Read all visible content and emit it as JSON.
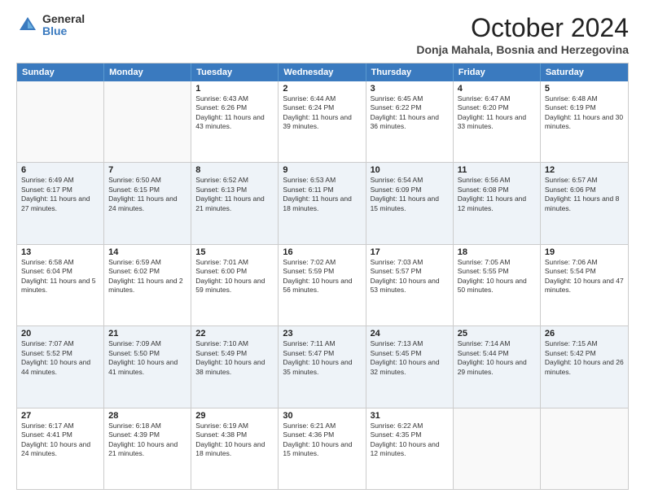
{
  "logo": {
    "general": "General",
    "blue": "Blue"
  },
  "header": {
    "month": "October 2024",
    "location": "Donja Mahala, Bosnia and Herzegovina"
  },
  "days": [
    "Sunday",
    "Monday",
    "Tuesday",
    "Wednesday",
    "Thursday",
    "Friday",
    "Saturday"
  ],
  "weeks": [
    [
      {
        "day": "",
        "info": ""
      },
      {
        "day": "",
        "info": ""
      },
      {
        "day": "1",
        "info": "Sunrise: 6:43 AM\nSunset: 6:26 PM\nDaylight: 11 hours and 43 minutes."
      },
      {
        "day": "2",
        "info": "Sunrise: 6:44 AM\nSunset: 6:24 PM\nDaylight: 11 hours and 39 minutes."
      },
      {
        "day": "3",
        "info": "Sunrise: 6:45 AM\nSunset: 6:22 PM\nDaylight: 11 hours and 36 minutes."
      },
      {
        "day": "4",
        "info": "Sunrise: 6:47 AM\nSunset: 6:20 PM\nDaylight: 11 hours and 33 minutes."
      },
      {
        "day": "5",
        "info": "Sunrise: 6:48 AM\nSunset: 6:19 PM\nDaylight: 11 hours and 30 minutes."
      }
    ],
    [
      {
        "day": "6",
        "info": "Sunrise: 6:49 AM\nSunset: 6:17 PM\nDaylight: 11 hours and 27 minutes."
      },
      {
        "day": "7",
        "info": "Sunrise: 6:50 AM\nSunset: 6:15 PM\nDaylight: 11 hours and 24 minutes."
      },
      {
        "day": "8",
        "info": "Sunrise: 6:52 AM\nSunset: 6:13 PM\nDaylight: 11 hours and 21 minutes."
      },
      {
        "day": "9",
        "info": "Sunrise: 6:53 AM\nSunset: 6:11 PM\nDaylight: 11 hours and 18 minutes."
      },
      {
        "day": "10",
        "info": "Sunrise: 6:54 AM\nSunset: 6:09 PM\nDaylight: 11 hours and 15 minutes."
      },
      {
        "day": "11",
        "info": "Sunrise: 6:56 AM\nSunset: 6:08 PM\nDaylight: 11 hours and 12 minutes."
      },
      {
        "day": "12",
        "info": "Sunrise: 6:57 AM\nSunset: 6:06 PM\nDaylight: 11 hours and 8 minutes."
      }
    ],
    [
      {
        "day": "13",
        "info": "Sunrise: 6:58 AM\nSunset: 6:04 PM\nDaylight: 11 hours and 5 minutes."
      },
      {
        "day": "14",
        "info": "Sunrise: 6:59 AM\nSunset: 6:02 PM\nDaylight: 11 hours and 2 minutes."
      },
      {
        "day": "15",
        "info": "Sunrise: 7:01 AM\nSunset: 6:00 PM\nDaylight: 10 hours and 59 minutes."
      },
      {
        "day": "16",
        "info": "Sunrise: 7:02 AM\nSunset: 5:59 PM\nDaylight: 10 hours and 56 minutes."
      },
      {
        "day": "17",
        "info": "Sunrise: 7:03 AM\nSunset: 5:57 PM\nDaylight: 10 hours and 53 minutes."
      },
      {
        "day": "18",
        "info": "Sunrise: 7:05 AM\nSunset: 5:55 PM\nDaylight: 10 hours and 50 minutes."
      },
      {
        "day": "19",
        "info": "Sunrise: 7:06 AM\nSunset: 5:54 PM\nDaylight: 10 hours and 47 minutes."
      }
    ],
    [
      {
        "day": "20",
        "info": "Sunrise: 7:07 AM\nSunset: 5:52 PM\nDaylight: 10 hours and 44 minutes."
      },
      {
        "day": "21",
        "info": "Sunrise: 7:09 AM\nSunset: 5:50 PM\nDaylight: 10 hours and 41 minutes."
      },
      {
        "day": "22",
        "info": "Sunrise: 7:10 AM\nSunset: 5:49 PM\nDaylight: 10 hours and 38 minutes."
      },
      {
        "day": "23",
        "info": "Sunrise: 7:11 AM\nSunset: 5:47 PM\nDaylight: 10 hours and 35 minutes."
      },
      {
        "day": "24",
        "info": "Sunrise: 7:13 AM\nSunset: 5:45 PM\nDaylight: 10 hours and 32 minutes."
      },
      {
        "day": "25",
        "info": "Sunrise: 7:14 AM\nSunset: 5:44 PM\nDaylight: 10 hours and 29 minutes."
      },
      {
        "day": "26",
        "info": "Sunrise: 7:15 AM\nSunset: 5:42 PM\nDaylight: 10 hours and 26 minutes."
      }
    ],
    [
      {
        "day": "27",
        "info": "Sunrise: 6:17 AM\nSunset: 4:41 PM\nDaylight: 10 hours and 24 minutes."
      },
      {
        "day": "28",
        "info": "Sunrise: 6:18 AM\nSunset: 4:39 PM\nDaylight: 10 hours and 21 minutes."
      },
      {
        "day": "29",
        "info": "Sunrise: 6:19 AM\nSunset: 4:38 PM\nDaylight: 10 hours and 18 minutes."
      },
      {
        "day": "30",
        "info": "Sunrise: 6:21 AM\nSunset: 4:36 PM\nDaylight: 10 hours and 15 minutes."
      },
      {
        "day": "31",
        "info": "Sunrise: 6:22 AM\nSunset: 4:35 PM\nDaylight: 10 hours and 12 minutes."
      },
      {
        "day": "",
        "info": ""
      },
      {
        "day": "",
        "info": ""
      }
    ]
  ]
}
